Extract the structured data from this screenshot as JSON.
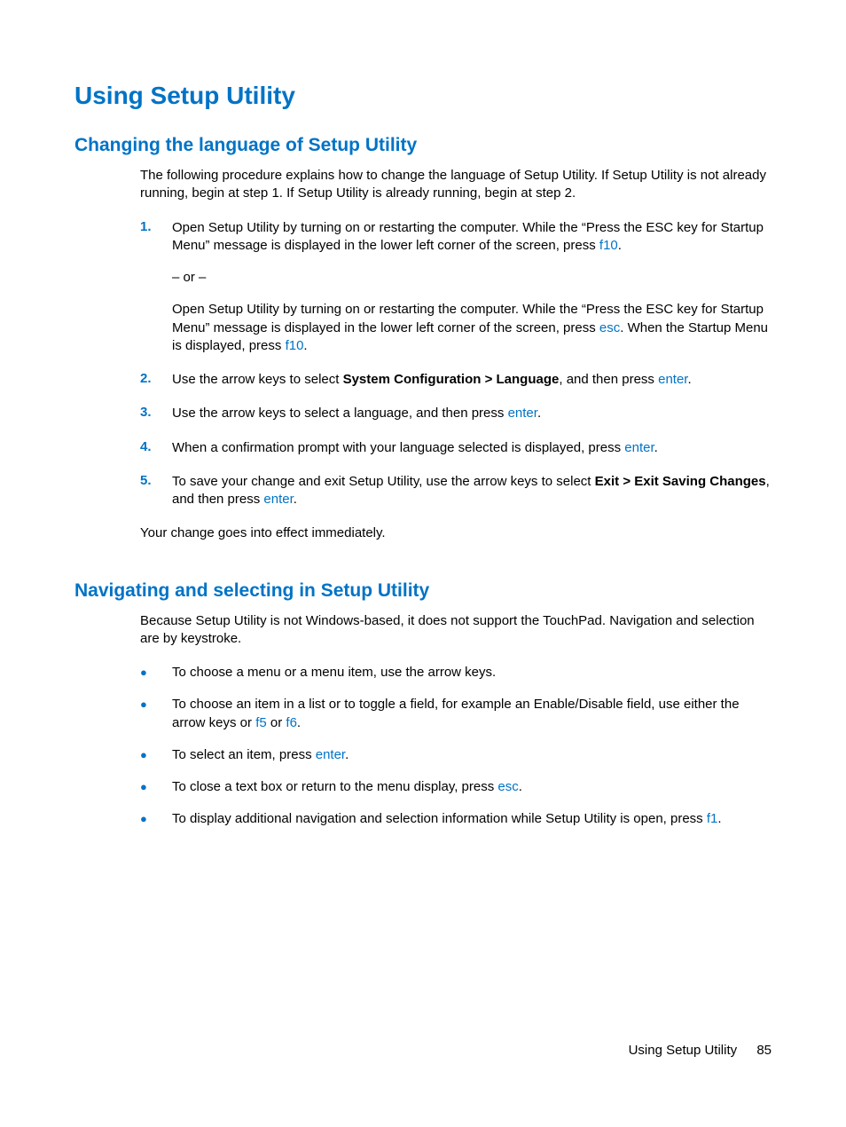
{
  "title": "Using Setup Utility",
  "section1": {
    "heading": "Changing the language of Setup Utility",
    "intro": "The following procedure explains how to change the language of Setup Utility. If Setup Utility is not already running, begin at step 1. If Setup Utility is already running, begin at step 2.",
    "steps": {
      "n1": "1.",
      "s1a_pre": "Open Setup Utility by turning on or restarting the computer. While the “Press the ESC key for Startup Menu” message is displayed in the lower left corner of the screen, press ",
      "s1a_key": "f10",
      "s1a_post": ".",
      "s1_or": "– or –",
      "s1b_pre": "Open Setup Utility by turning on or restarting the computer. While the “Press the ESC key for Startup Menu” message is displayed in the lower left corner of the screen, press ",
      "s1b_key1": "esc",
      "s1b_mid": ". When the Startup Menu is displayed, press ",
      "s1b_key2": "f10",
      "s1b_post": ".",
      "n2": "2.",
      "s2_pre": "Use the arrow keys to select ",
      "s2_bold": "System Configuration > Language",
      "s2_mid": ", and then press ",
      "s2_key": "enter",
      "s2_post": ".",
      "n3": "3.",
      "s3_pre": "Use the arrow keys to select a language, and then press ",
      "s3_key": "enter",
      "s3_post": ".",
      "n4": "4.",
      "s4_pre": "When a confirmation prompt with your language selected is displayed, press ",
      "s4_key": "enter",
      "s4_post": ".",
      "n5": "5.",
      "s5_pre": "To save your change and exit Setup Utility, use the arrow keys to select ",
      "s5_bold": "Exit > Exit Saving Changes",
      "s5_mid": ", and then press ",
      "s5_key": "enter",
      "s5_post": "."
    },
    "outro": "Your change goes into effect immediately."
  },
  "section2": {
    "heading": "Navigating and selecting in Setup Utility",
    "intro": "Because Setup Utility is not Windows-based, it does not support the TouchPad. Navigation and selection are by keystroke.",
    "bullets": {
      "b1": "To choose a menu or a menu item, use the arrow keys.",
      "b2_pre": "To choose an item in a list or to toggle a field, for example an Enable/Disable field, use either the arrow keys or ",
      "b2_key1": "f5",
      "b2_mid": " or ",
      "b2_key2": "f6",
      "b2_post": ".",
      "b3_pre": "To select an item, press ",
      "b3_key": "enter",
      "b3_post": ".",
      "b4_pre": "To close a text box or return to the menu display, press ",
      "b4_key": "esc",
      "b4_post": ".",
      "b5_pre": "To display additional navigation and selection information while Setup Utility is open, press ",
      "b5_key": "f1",
      "b5_post": "."
    }
  },
  "footer": {
    "label": "Using Setup Utility",
    "page": "85"
  },
  "glyphs": {
    "bullet": "●"
  }
}
